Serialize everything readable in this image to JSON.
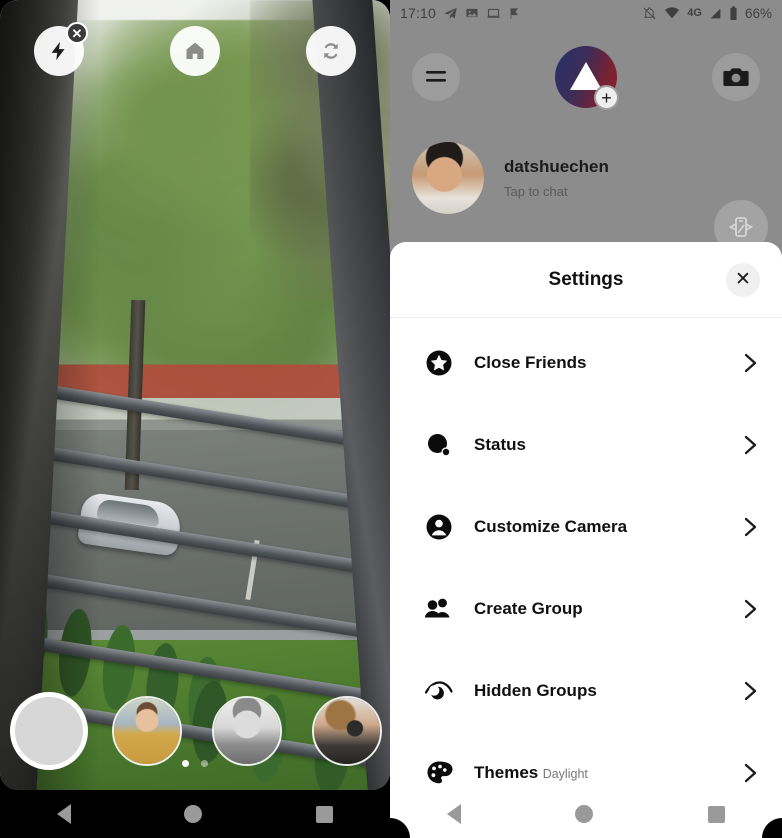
{
  "left_phone": {
    "camera": {
      "flash_button": "flash-off",
      "flash_badge": "✕",
      "home_button": "home",
      "flip_button": "switch-camera",
      "shutter_button": "shutter",
      "contacts": [
        "contact-1",
        "contact-2",
        "contact-3"
      ],
      "page_dots": [
        "active",
        "inactive"
      ]
    },
    "navbar": {
      "back": "back",
      "home": "home",
      "recents": "recents"
    }
  },
  "right_phone": {
    "statusbar": {
      "time": "17:10",
      "left_icons": [
        "telegram-icon",
        "photo-icon",
        "laptop-icon",
        "flag-icon"
      ],
      "right_icons": [
        "bell-off-icon",
        "wifi-icon",
        "signal-icon",
        "battery-icon"
      ],
      "network": "4G",
      "battery": "66%"
    },
    "app_bar": {
      "menu_button": "menu",
      "logo": "app-logo",
      "logo_badge": "+",
      "camera_button": "camera"
    },
    "chat": {
      "name": "datshuechen",
      "subtitle": "Tap to chat"
    },
    "fab": "device-rotate",
    "settings_sheet": {
      "title": "Settings",
      "close": "✕",
      "items": [
        {
          "label": "Close Friends",
          "sub": "",
          "icon": "star-circle-icon"
        },
        {
          "label": "Status",
          "sub": "",
          "icon": "status-dot-icon"
        },
        {
          "label": "Customize Camera",
          "sub": "",
          "icon": "person-circle-icon"
        },
        {
          "label": "Create Group",
          "sub": "",
          "icon": "people-icon"
        },
        {
          "label": "Hidden Groups",
          "sub": "",
          "icon": "eye-hidden-icon"
        },
        {
          "label": "Themes",
          "sub": "Daylight",
          "icon": "palette-icon"
        }
      ]
    },
    "navbar": {
      "back": "back",
      "home": "home",
      "recents": "recents"
    },
    "colors": {
      "sheet_bg": "#ffffff",
      "scrim": "#8c8c8c",
      "accent_navy": "#27306b",
      "accent_red": "#8d2030",
      "text_primary": "#101010",
      "text_secondary": "#777777"
    }
  }
}
